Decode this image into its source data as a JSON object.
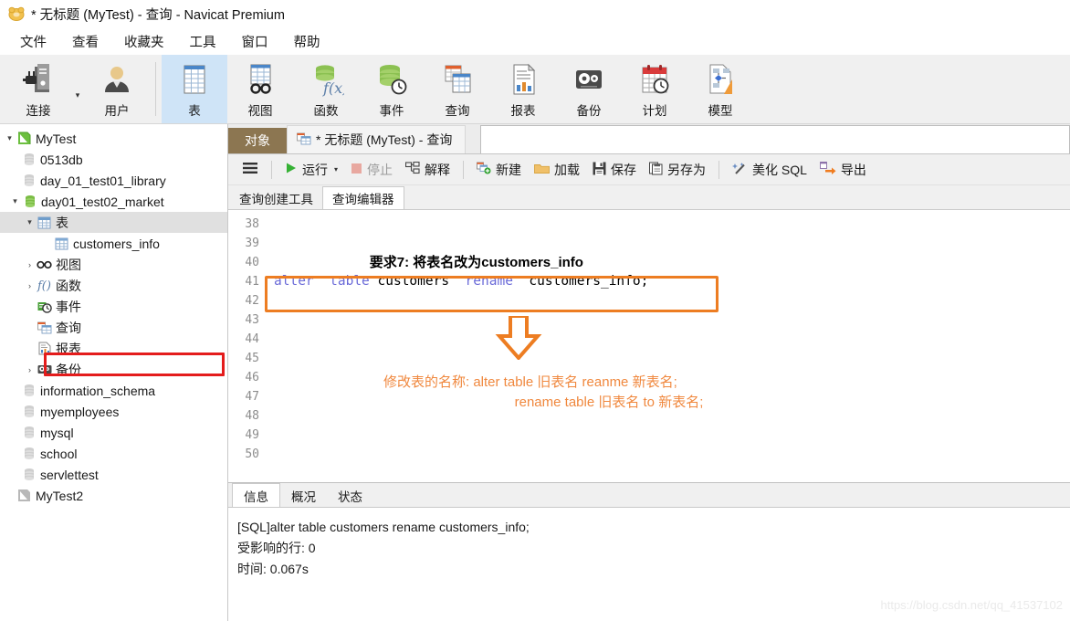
{
  "window": {
    "title": "* 无标题 (MyTest) - 查询 - Navicat Premium",
    "logo_icon": "navicat-logo-icon"
  },
  "menu": {
    "items": [
      {
        "label": "文件",
        "name": "menu-file"
      },
      {
        "label": "查看",
        "name": "menu-view"
      },
      {
        "label": "收藏夹",
        "name": "menu-favorites"
      },
      {
        "label": "工具",
        "name": "menu-tools"
      },
      {
        "label": "窗口",
        "name": "menu-window"
      },
      {
        "label": "帮助",
        "name": "menu-help"
      }
    ]
  },
  "ribbon": {
    "buttons": [
      {
        "label": "连接",
        "icon": "connection-icon",
        "active": false
      },
      {
        "label": "用户",
        "icon": "user-icon",
        "active": false
      },
      {
        "label": "表",
        "icon": "table-icon",
        "active": true
      },
      {
        "label": "视图",
        "icon": "view-icon",
        "active": false
      },
      {
        "label": "函数",
        "icon": "function-icon",
        "active": false
      },
      {
        "label": "事件",
        "icon": "event-icon",
        "active": false
      },
      {
        "label": "查询",
        "icon": "query-icon",
        "active": false
      },
      {
        "label": "报表",
        "icon": "report-icon",
        "active": false
      },
      {
        "label": "备份",
        "icon": "backup-icon",
        "active": false
      },
      {
        "label": "计划",
        "icon": "schedule-icon",
        "active": false
      },
      {
        "label": "模型",
        "icon": "model-icon",
        "active": false
      }
    ],
    "connection_dropdown_caret": "▾"
  },
  "sidebar": {
    "nodes": [
      {
        "label": "MyTest",
        "icon": "server-connection-icon",
        "indent": 0,
        "twisty": "▾",
        "selected": false
      },
      {
        "label": "0513db",
        "icon": "database-gray-icon",
        "indent": 1,
        "twisty": "",
        "selected": false
      },
      {
        "label": "day_01_test01_library",
        "icon": "database-gray-icon",
        "indent": 1,
        "twisty": "",
        "selected": false
      },
      {
        "label": "day01_test02_market",
        "icon": "database-green-icon",
        "indent": 1,
        "twisty": "▾",
        "selected": false
      },
      {
        "label": "表",
        "icon": "tables-folder-icon",
        "indent": 2,
        "twisty": "▾",
        "selected": true
      },
      {
        "label": "customers_info",
        "icon": "table-item-icon",
        "indent": 3,
        "twisty": "",
        "selected": false
      },
      {
        "label": "视图",
        "icon": "views-folder-icon",
        "indent": 2,
        "twisty": "›",
        "selected": false
      },
      {
        "label": "函数",
        "icon": "functions-folder-icon",
        "indent": 2,
        "twisty": "›",
        "selected": false
      },
      {
        "label": "事件",
        "icon": "events-folder-icon",
        "indent": 2,
        "twisty": "",
        "selected": false
      },
      {
        "label": "查询",
        "icon": "queries-folder-icon",
        "indent": 2,
        "twisty": "",
        "selected": false
      },
      {
        "label": "报表",
        "icon": "reports-folder-icon",
        "indent": 2,
        "twisty": "",
        "selected": false
      },
      {
        "label": "备份",
        "icon": "backups-folder-icon",
        "indent": 2,
        "twisty": "›",
        "selected": false
      },
      {
        "label": "information_schema",
        "icon": "database-gray-icon",
        "indent": 1,
        "twisty": "",
        "selected": false
      },
      {
        "label": "myemployees",
        "icon": "database-gray-icon",
        "indent": 1,
        "twisty": "",
        "selected": false
      },
      {
        "label": "mysql",
        "icon": "database-gray-icon",
        "indent": 1,
        "twisty": "",
        "selected": false
      },
      {
        "label": "school",
        "icon": "database-gray-icon",
        "indent": 1,
        "twisty": "",
        "selected": false
      },
      {
        "label": "servlettest",
        "icon": "database-gray-icon",
        "indent": 1,
        "twisty": "",
        "selected": false
      },
      {
        "label": "MyTest2",
        "icon": "server-connection-gray-icon",
        "indent": 0,
        "twisty": "",
        "selected": false
      }
    ]
  },
  "tabstrip": {
    "object_tab": "对象",
    "query_tab": "* 无标题 (MyTest) - 查询",
    "query_tab_icon": "query-tab-icon"
  },
  "actionbar": {
    "menu_icon": "hamburger-menu-icon",
    "items": [
      {
        "label": "运行",
        "icon": "run-play-icon",
        "disabled": false,
        "caret": "▾"
      },
      {
        "label": "停止",
        "icon": "stop-square-icon",
        "disabled": true,
        "caret": ""
      },
      {
        "label": "解释",
        "icon": "explain-icon",
        "disabled": false,
        "caret": ""
      },
      {
        "label": "新建",
        "icon": "new-query-icon",
        "disabled": false,
        "caret": ""
      },
      {
        "label": "加载",
        "icon": "load-folder-icon",
        "disabled": false,
        "caret": ""
      },
      {
        "label": "保存",
        "icon": "save-disk-icon",
        "disabled": false,
        "caret": ""
      },
      {
        "label": "另存为",
        "icon": "save-as-icon",
        "disabled": false,
        "caret": ""
      },
      {
        "label": "美化 SQL",
        "icon": "beautify-sql-icon",
        "disabled": false,
        "caret": ""
      },
      {
        "label": "导出",
        "icon": "export-arrow-icon",
        "disabled": false,
        "caret": ""
      }
    ]
  },
  "subtabs": [
    {
      "label": "查询创建工具",
      "active": false
    },
    {
      "label": "查询编辑器",
      "active": true
    }
  ],
  "editor": {
    "line_numbers": [
      38,
      39,
      40,
      41,
      42,
      43,
      44,
      45,
      46,
      47,
      48,
      49,
      50
    ],
    "lines": [
      {
        "num": 38,
        "segments": []
      },
      {
        "num": 39,
        "segments": [
          {
            "t": "要求7: 将表名改为customers_info",
            "k": "cn"
          }
        ]
      },
      {
        "num": 40,
        "segments": []
      },
      {
        "num": 41,
        "segments": [
          {
            "t": "alter",
            "k": "kw"
          },
          {
            "t": "  ",
            "k": "p"
          },
          {
            "t": "table",
            "k": "kw"
          },
          {
            "t": " customers  ",
            "k": "p"
          },
          {
            "t": "rename",
            "k": "kw"
          },
          {
            "t": "  customers_info;",
            "k": "p"
          }
        ]
      },
      {
        "num": 42,
        "segments": []
      },
      {
        "num": 43,
        "segments": []
      },
      {
        "num": 44,
        "segments": []
      },
      {
        "num": 45,
        "segments": []
      },
      {
        "num": 46,
        "segments": []
      },
      {
        "num": 47,
        "segments": []
      },
      {
        "num": 48,
        "segments": []
      },
      {
        "num": 49,
        "segments": []
      },
      {
        "num": 50,
        "segments": []
      }
    ]
  },
  "annotation": {
    "highlight_color": "#ed7d22",
    "arrow_icon": "down-arrow-annotation",
    "line1": "修改表的名称: alter  table 旧表名   reanme 新表名;",
    "line2": "rename  table 旧表名 to 新表名;"
  },
  "results": {
    "tabs": [
      {
        "label": "信息",
        "active": true
      },
      {
        "label": "概况",
        "active": false
      },
      {
        "label": "状态",
        "active": false
      }
    ],
    "lines": [
      "[SQL]alter  table customers  rename  customers_info;",
      "受影响的行: 0",
      "时间: 0.067s"
    ]
  },
  "watermark": "https://blog.csdn.net/qq_41537102"
}
